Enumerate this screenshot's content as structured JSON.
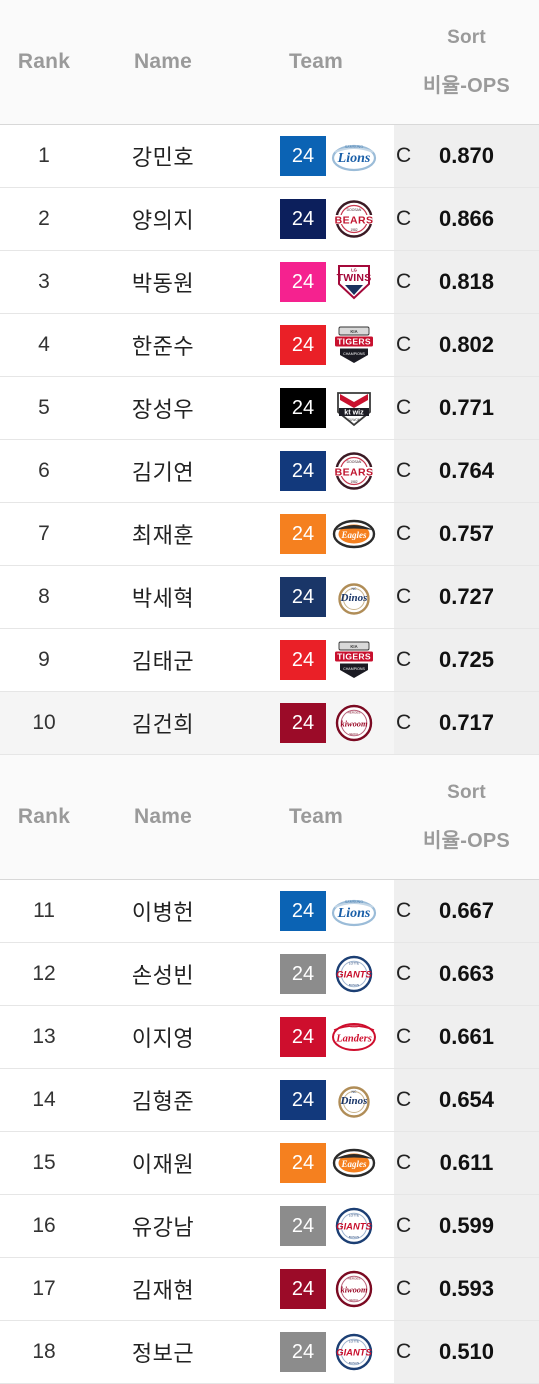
{
  "table": {
    "columns": {
      "rank": "Rank",
      "name": "Name",
      "team": "Team",
      "sort": "Sort",
      "stat": "비율-OPS"
    },
    "colors": {
      "header_bg": "#fafafa",
      "header_text": "#9a9a9a",
      "stat_column_bg": "#efefef",
      "row_highlight_bg": "#f5f5f5",
      "row_border": "#e6e6e6"
    },
    "sections": [
      {
        "rows": [
          {
            "rank": "1",
            "name": "강민호",
            "jersey": "24",
            "jersey_color": "#0b63b4",
            "team_logo": "samsung-lions-logo",
            "position": "C",
            "stat": "0.870",
            "highlight": false
          },
          {
            "rank": "2",
            "name": "양의지",
            "jersey": "24",
            "jersey_color": "#0c1f5c",
            "team_logo": "doosan-bears-logo",
            "position": "C",
            "stat": "0.866",
            "highlight": false
          },
          {
            "rank": "3",
            "name": "박동원",
            "jersey": "24",
            "jersey_color": "#f5228f",
            "team_logo": "lg-twins-logo",
            "position": "C",
            "stat": "0.818",
            "highlight": false
          },
          {
            "rank": "4",
            "name": "한준수",
            "jersey": "24",
            "jersey_color": "#ea2027",
            "team_logo": "kia-tigers-logo",
            "position": "C",
            "stat": "0.802",
            "highlight": false
          },
          {
            "rank": "5",
            "name": "장성우",
            "jersey": "24",
            "jersey_color": "#000000",
            "team_logo": "kt-wiz-logo",
            "position": "C",
            "stat": "0.771",
            "highlight": false
          },
          {
            "rank": "6",
            "name": "김기연",
            "jersey": "24",
            "jersey_color": "#12397c",
            "team_logo": "doosan-bears-logo",
            "position": "C",
            "stat": "0.764",
            "highlight": false
          },
          {
            "rank": "7",
            "name": "최재훈",
            "jersey": "24",
            "jersey_color": "#f5801f",
            "team_logo": "hanwha-eagles-logo",
            "position": "C",
            "stat": "0.757",
            "highlight": false
          },
          {
            "rank": "8",
            "name": "박세혁",
            "jersey": "24",
            "jersey_color": "#1a3668",
            "team_logo": "nc-dinos-logo",
            "position": "C",
            "stat": "0.727",
            "highlight": false
          },
          {
            "rank": "9",
            "name": "김태군",
            "jersey": "24",
            "jersey_color": "#ea2027",
            "team_logo": "kia-tigers-logo",
            "position": "C",
            "stat": "0.725",
            "highlight": false
          },
          {
            "rank": "10",
            "name": "김건희",
            "jersey": "24",
            "jersey_color": "#9b0b28",
            "team_logo": "kiwoom-heroes-logo",
            "position": "C",
            "stat": "0.717",
            "highlight": true
          }
        ]
      },
      {
        "rows": [
          {
            "rank": "11",
            "name": "이병헌",
            "jersey": "24",
            "jersey_color": "#0b63b4",
            "team_logo": "samsung-lions-logo",
            "position": "C",
            "stat": "0.667",
            "highlight": false
          },
          {
            "rank": "12",
            "name": "손성빈",
            "jersey": "24",
            "jersey_color": "#8c8c8c",
            "team_logo": "lotte-giants-logo",
            "position": "C",
            "stat": "0.663",
            "highlight": false
          },
          {
            "rank": "13",
            "name": "이지영",
            "jersey": "24",
            "jersey_color": "#ce0e2d",
            "team_logo": "ssg-landers-logo",
            "position": "C",
            "stat": "0.661",
            "highlight": false
          },
          {
            "rank": "14",
            "name": "김형준",
            "jersey": "24",
            "jersey_color": "#12397c",
            "team_logo": "nc-dinos-logo",
            "position": "C",
            "stat": "0.654",
            "highlight": false
          },
          {
            "rank": "15",
            "name": "이재원",
            "jersey": "24",
            "jersey_color": "#f5801f",
            "team_logo": "hanwha-eagles-logo",
            "position": "C",
            "stat": "0.611",
            "highlight": false
          },
          {
            "rank": "16",
            "name": "유강남",
            "jersey": "24",
            "jersey_color": "#8c8c8c",
            "team_logo": "lotte-giants-logo",
            "position": "C",
            "stat": "0.599",
            "highlight": false
          },
          {
            "rank": "17",
            "name": "김재현",
            "jersey": "24",
            "jersey_color": "#9b0b28",
            "team_logo": "kiwoom-heroes-logo",
            "position": "C",
            "stat": "0.593",
            "highlight": false
          },
          {
            "rank": "18",
            "name": "정보근",
            "jersey": "24",
            "jersey_color": "#8c8c8c",
            "team_logo": "lotte-giants-logo",
            "position": "C",
            "stat": "0.510",
            "highlight": false
          }
        ]
      }
    ]
  }
}
